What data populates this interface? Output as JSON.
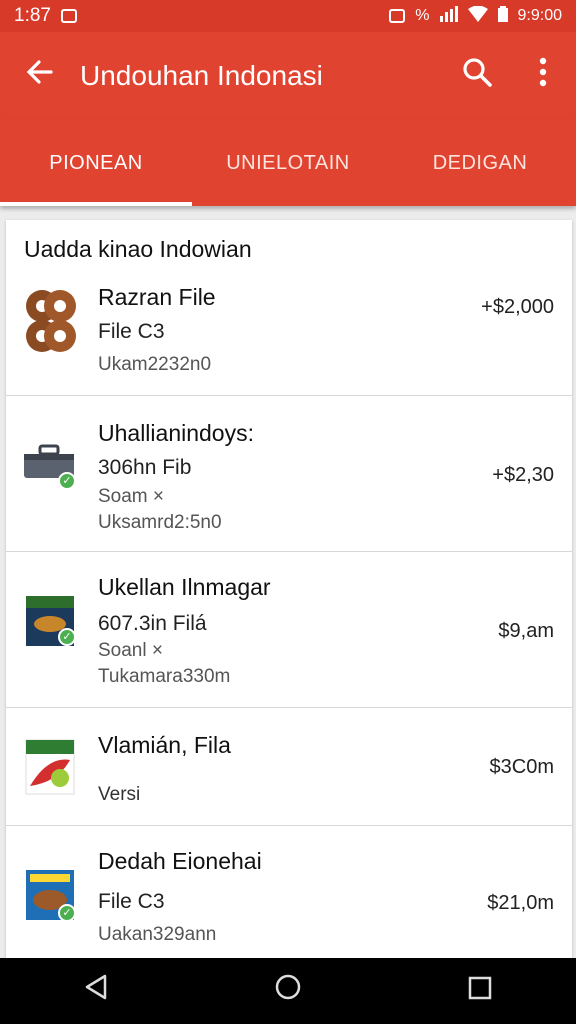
{
  "status_bar": {
    "time_left": "1:87",
    "time_right": "9:9:00",
    "icons": [
      "notification-icon",
      "wifi-icon",
      "signal-icon",
      "battery-icon"
    ],
    "percent": "%"
  },
  "app_bar": {
    "title": "Undouhan Indonasi",
    "back_icon": "arrow-left-icon",
    "search_icon": "search-icon",
    "more_icon": "more-vert-icon"
  },
  "tabs": [
    {
      "label": "PIONEAN",
      "active": true
    },
    {
      "label": "UNIELOTAIN",
      "active": false
    },
    {
      "label": "DEDIGAN",
      "active": false
    }
  ],
  "section": {
    "title": "Uadda kinao Indowian"
  },
  "items": [
    {
      "title": "Razran File",
      "line2": "File C3",
      "line3": "Ukam2232n0",
      "price": "+$2,000"
    },
    {
      "title": "Uhallianindoys:",
      "line2": "306hn Fib",
      "line3": "Soam ×",
      "line4": "Uksamrd2:5n0",
      "price": "+$2,30"
    },
    {
      "title": "Ukellan Ilnmagar",
      "line2": "607.3in Filá",
      "line3": "Soanl ×",
      "line4": "Tukamara330m",
      "price": "$9,am"
    },
    {
      "title": "Vlamián, Fila",
      "line2": "Versi",
      "price": "$3C0m"
    },
    {
      "title": "Dedah Eionehai",
      "line2": "File C3",
      "line3": "Uakan329ann",
      "price": "$21,0m"
    }
  ],
  "colors": {
    "accent": "#e14331",
    "status_bar": "#d83a2a",
    "check": "#4caf50"
  }
}
